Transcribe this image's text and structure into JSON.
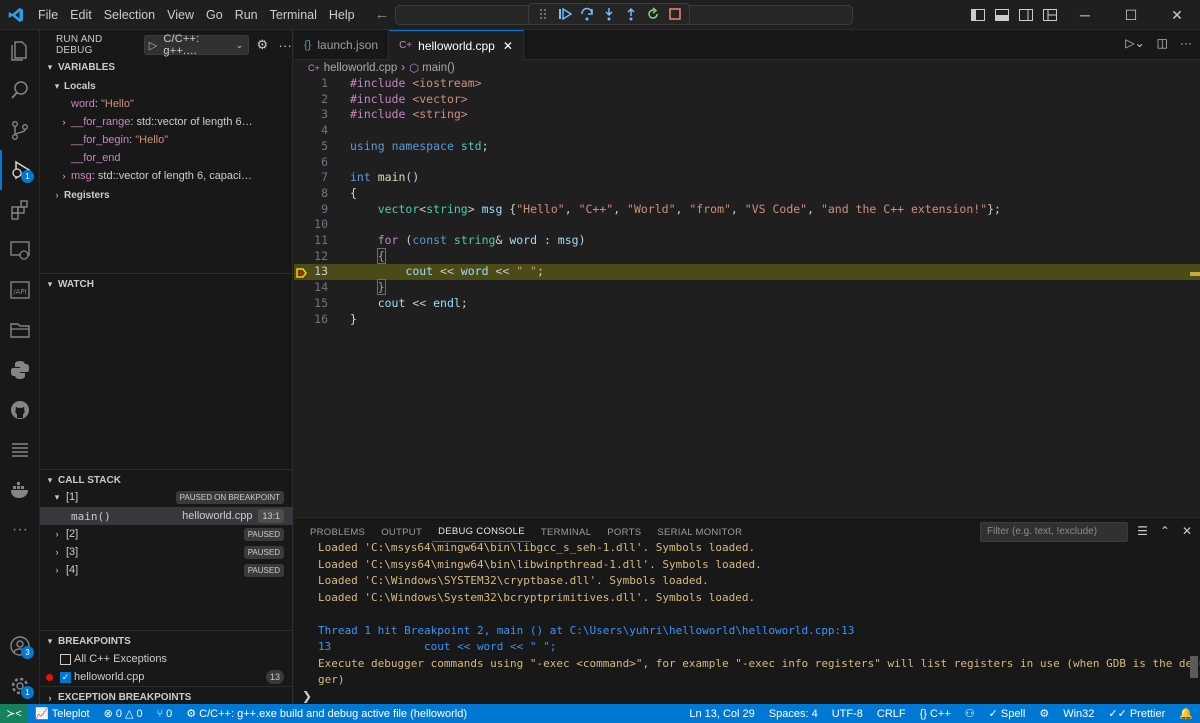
{
  "menu": [
    "File",
    "Edit",
    "Selection",
    "View",
    "Go",
    "Run",
    "Terminal",
    "Help"
  ],
  "sidebar": {
    "title": "RUN AND DEBUG",
    "config": "C/C++: g++.…",
    "variables_title": "VARIABLES",
    "locals_label": "Locals",
    "variables": [
      {
        "name": "word",
        "value": "\"Hello\"",
        "expandable": false
      },
      {
        "name": "__for_range",
        "value": "std::vector of length 6…",
        "expandable": true
      },
      {
        "name": "__for_begin",
        "value": "\"Hello\"",
        "expandable": false
      },
      {
        "name": "__for_end",
        "value": "",
        "expandable": false
      },
      {
        "name": "msg",
        "value": "std::vector of length 6, capaci…",
        "expandable": true
      }
    ],
    "registers_label": "Registers",
    "watch_title": "WATCH",
    "callstack_title": "CALL STACK",
    "threads": [
      {
        "label": "[1]",
        "status": "PAUSED ON BREAKPOINT"
      },
      {
        "label": "[2]",
        "status": "PAUSED"
      },
      {
        "label": "[3]",
        "status": "PAUSED"
      },
      {
        "label": "[4]",
        "status": "PAUSED"
      }
    ],
    "frame": {
      "fn": "main()",
      "file": "helloworld.cpp",
      "pos": "13:1"
    },
    "breakpoints_title": "BREAKPOINTS",
    "breakpoints": [
      {
        "label": "All C++ Exceptions"
      },
      {
        "label": "helloworld.cpp",
        "count": "13"
      }
    ],
    "exception_bp_title": "EXCEPTION BREAKPOINTS"
  },
  "badges": {
    "debug": "1",
    "accounts": "3",
    "manage": "1"
  },
  "tabs": [
    {
      "label": "launch.json"
    },
    {
      "label": "helloworld.cpp"
    }
  ],
  "breadcrumb": {
    "file": "helloworld.cpp",
    "symbol": "main()"
  },
  "current_line": 13,
  "panel": {
    "tabs": [
      "PROBLEMS",
      "OUTPUT",
      "DEBUG CONSOLE",
      "TERMINAL",
      "PORTS",
      "SERIAL MONITOR"
    ],
    "filter_placeholder": "Filter (e.g. text, !exclude)",
    "lines": [
      {
        "text": "Loaded 'C:\\msys64\\mingw64\\bin\\libgcc_s_seh-1.dll'. Symbols loaded.",
        "kind": "o"
      },
      {
        "text": "Loaded 'C:\\msys64\\mingw64\\bin\\libwinpthread-1.dll'. Symbols loaded.",
        "kind": "o"
      },
      {
        "text": "Loaded 'C:\\Windows\\SYSTEM32\\cryptbase.dll'. Symbols loaded.",
        "kind": "o"
      },
      {
        "text": "Loaded 'C:\\Windows\\System32\\bcryptprimitives.dll'. Symbols loaded.",
        "kind": "o"
      },
      {
        "text": "",
        "kind": "o"
      },
      {
        "text": "Thread 1 hit Breakpoint 2, main () at C:\\Users\\yuhri\\helloworld\\helloworld.cpp:13",
        "kind": "b"
      },
      {
        "text": "13              cout << word << \" \";",
        "kind": "b"
      },
      {
        "text": "Execute debugger commands using \"-exec <command>\", for example \"-exec info registers\" will list registers in use (when GDB is the debug",
        "kind": "o"
      },
      {
        "text": "ger)",
        "kind": "o"
      }
    ],
    "prompt": "❯"
  },
  "status": {
    "teleplot": "Teleplot",
    "errors": "0",
    "warnings": "0",
    "ports": "0",
    "launch": "C/C++: g++.exe build and debug active file (helloworld)",
    "position": "Ln 13, Col 29",
    "spaces": "Spaces: 4",
    "encoding": "UTF-8",
    "eol": "CRLF",
    "language": "C++",
    "spell": "Spell",
    "platform": "Win32",
    "prettier": "Prettier"
  },
  "icons": [
    "vscode-logo-icon",
    "explorer-icon",
    "search-icon",
    "source-control-icon",
    "run-debug-icon",
    "extensions-icon",
    "remote-explorer-icon",
    "api-icon",
    "folder-icon",
    "python-icon",
    "github-icon",
    "testing-icon",
    "docker-icon",
    "accounts-icon",
    "manage-gear-icon"
  ],
  "colors": {
    "accent": "#0078d4",
    "current_line": "#4b4b18",
    "breakpoint": "#e51400",
    "statusbar": "#0078d4"
  }
}
